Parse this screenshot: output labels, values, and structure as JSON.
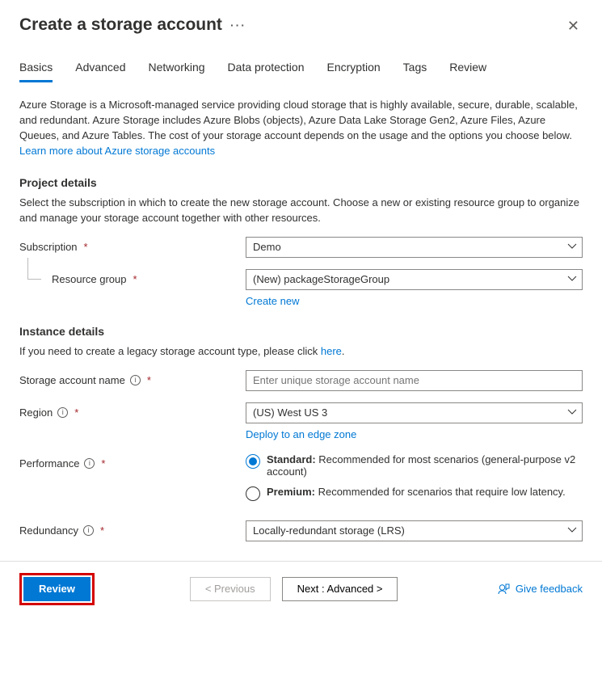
{
  "header": {
    "title": "Create a storage account",
    "close_label": "✕"
  },
  "tabs": [
    {
      "id": "basics",
      "label": "Basics",
      "active": true
    },
    {
      "id": "advanced",
      "label": "Advanced"
    },
    {
      "id": "networking",
      "label": "Networking"
    },
    {
      "id": "dataprotection",
      "label": "Data protection"
    },
    {
      "id": "encryption",
      "label": "Encryption"
    },
    {
      "id": "tags",
      "label": "Tags"
    },
    {
      "id": "review",
      "label": "Review"
    }
  ],
  "intro": {
    "text": "Azure Storage is a Microsoft-managed service providing cloud storage that is highly available, secure, durable, scalable, and redundant. Azure Storage includes Azure Blobs (objects), Azure Data Lake Storage Gen2, Azure Files, Azure Queues, and Azure Tables. The cost of your storage account depends on the usage and the options you choose below. ",
    "learn_more": "Learn more about Azure storage accounts"
  },
  "project_details": {
    "heading": "Project details",
    "desc": "Select the subscription in which to create the new storage account. Choose a new or existing resource group to organize and manage your storage account together with other resources.",
    "subscription_label": "Subscription",
    "subscription_value": "Demo",
    "resource_group_label": "Resource group",
    "resource_group_value": "(New) packageStorageGroup",
    "create_new": "Create new"
  },
  "instance_details": {
    "heading": "Instance details",
    "legacy_text": "If you need to create a legacy storage account type, please click ",
    "legacy_link": "here",
    "name_label": "Storage account name",
    "name_placeholder": "Enter unique storage account name",
    "region_label": "Region",
    "region_value": "(US) West US 3",
    "deploy_edge": "Deploy to an edge zone",
    "performance_label": "Performance",
    "perf_standard_bold": "Standard:",
    "perf_standard_text": " Recommended for most scenarios (general-purpose v2 account)",
    "perf_premium_bold": "Premium:",
    "perf_premium_text": " Recommended for scenarios that require low latency.",
    "redundancy_label": "Redundancy",
    "redundancy_value": "Locally-redundant storage (LRS)"
  },
  "footer": {
    "review": "Review",
    "previous": "< Previous",
    "next": "Next : Advanced >",
    "feedback": "Give feedback"
  }
}
